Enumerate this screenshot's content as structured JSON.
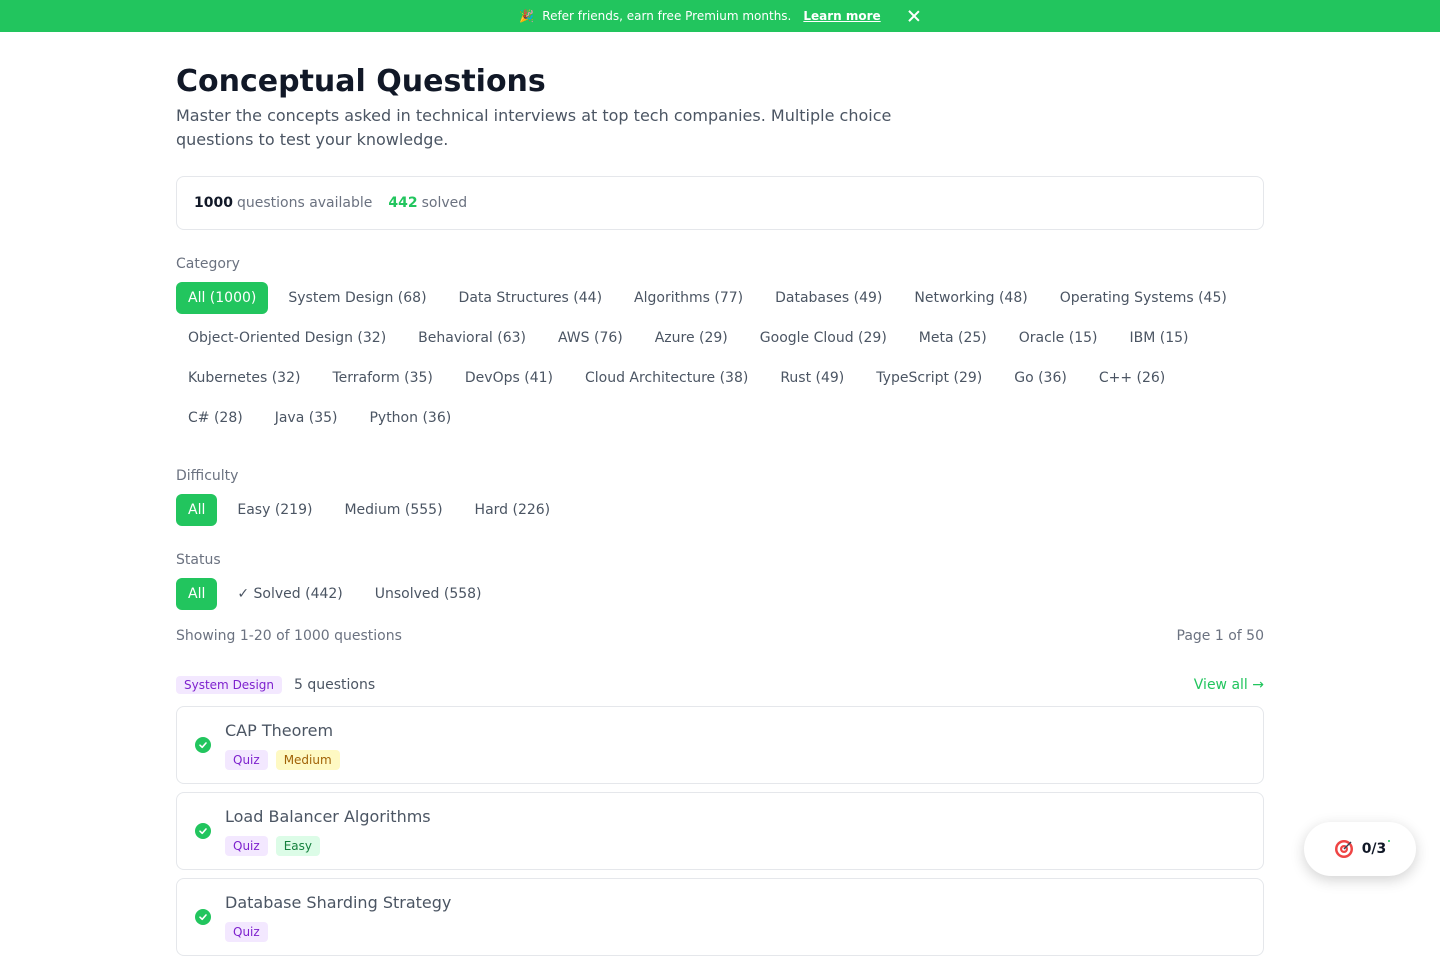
{
  "banner": {
    "emoji": "🎉",
    "text": "Refer friends, earn free Premium months.",
    "link": "Learn more"
  },
  "header": {
    "title": "Conceptual Questions",
    "subtitle": "Master the concepts asked in technical interviews at top tech companies. Multiple choice questions to test your knowledge."
  },
  "stats": {
    "total": "1000",
    "total_label": "questions available",
    "solved": "442",
    "solved_label": "solved"
  },
  "filters": {
    "category_label": "Category",
    "categories": [
      "All (1000)",
      "System Design (68)",
      "Data Structures (44)",
      "Algorithms (77)",
      "Databases (49)",
      "Networking (48)",
      "Operating Systems (45)",
      "Object-Oriented Design (32)",
      "Behavioral (63)",
      "AWS (76)",
      "Azure (29)",
      "Google Cloud (29)",
      "Meta (25)",
      "Oracle (15)",
      "IBM (15)",
      "Kubernetes (32)",
      "Terraform (35)",
      "DevOps (41)",
      "Cloud Architecture (38)",
      "Rust (49)",
      "TypeScript (29)",
      "Go (36)",
      "C++ (26)",
      "C# (28)",
      "Java (35)",
      "Python (36)"
    ],
    "difficulty_label": "Difficulty",
    "difficulties": [
      "All",
      "Easy (219)",
      "Medium (555)",
      "Hard (226)"
    ],
    "status_label": "Status",
    "statuses": [
      "All",
      "✓ Solved (442)",
      "Unsolved (558)"
    ]
  },
  "results": {
    "showing": "Showing 1-20 of 1000 questions",
    "page": "Page 1 of 50"
  },
  "group": {
    "tag": "System Design",
    "count": "5 questions",
    "view_all": "View all →"
  },
  "questions": [
    {
      "title": "CAP Theorem",
      "type": "Quiz",
      "difficulty": "Medium"
    },
    {
      "title": "Load Balancer Algorithms",
      "type": "Quiz",
      "difficulty": "Easy"
    },
    {
      "title": "Database Sharding Strategy",
      "type": "Quiz",
      "difficulty": ""
    }
  ],
  "widget": {
    "progress": "0/3"
  },
  "colors": {
    "accent": "#22c55e",
    "tag_purple_bg": "#f3e8ff",
    "tag_medium_bg": "#fef9c3",
    "tag_easy_bg": "#dcfce7"
  }
}
